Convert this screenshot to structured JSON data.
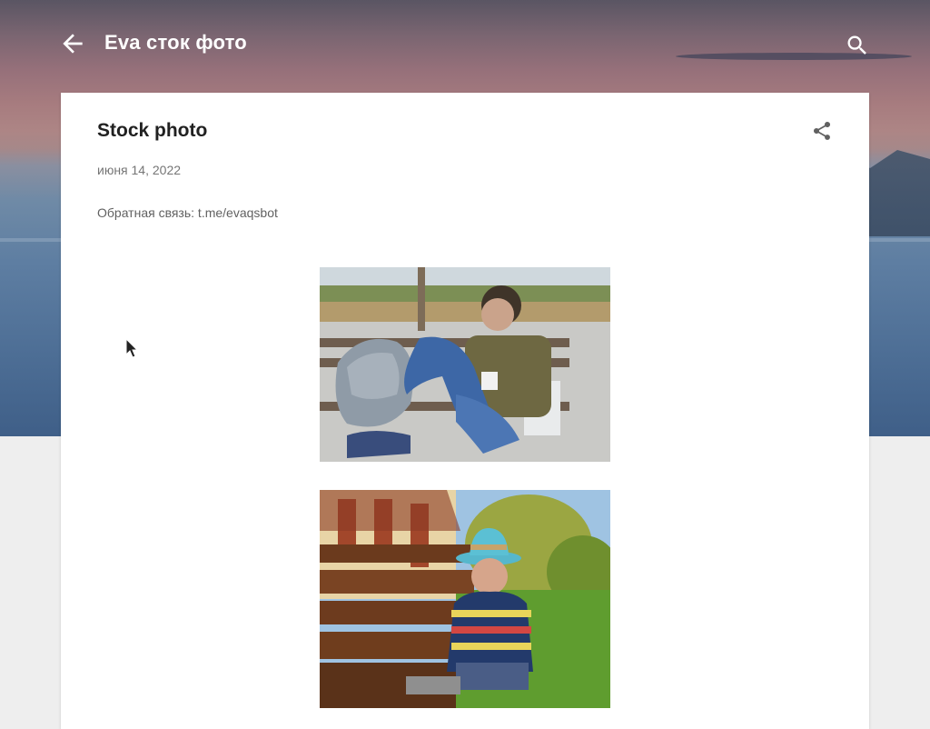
{
  "header": {
    "title": "Eva сток фото",
    "back_icon": "arrow-left-icon",
    "search_icon": "search-icon"
  },
  "post": {
    "title": "Stock photo",
    "date": "июня 14, 2022",
    "feedback": "Обратная связь: t.me/evaqsbot",
    "share_icon": "share-icon"
  },
  "images": [
    {
      "name": "boy-on-bench-photo"
    },
    {
      "name": "boy-with-hat-photo"
    }
  ],
  "colors": {
    "title_text": "#ffffff",
    "post_title": "#212121",
    "meta_text": "#757575",
    "card_bg": "#ffffff",
    "page_bg": "#eeeeee"
  }
}
